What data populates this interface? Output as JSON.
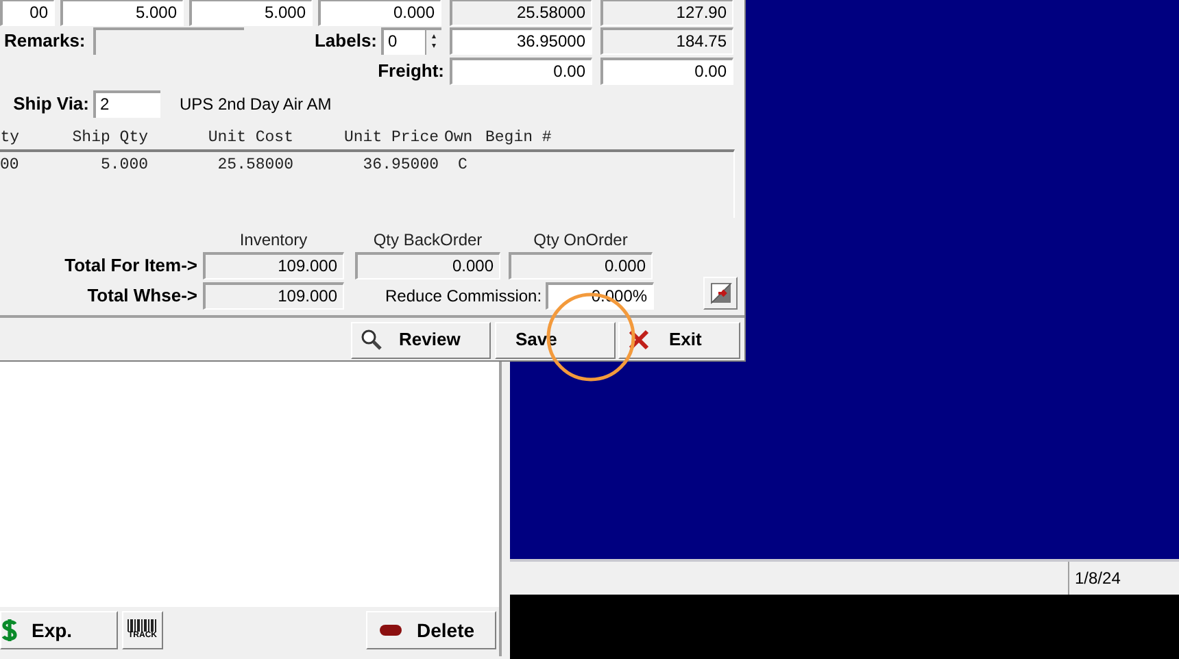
{
  "order_dialog": {
    "line_row": [
      {
        "value": "00",
        "readonly": false
      },
      {
        "value": "5.000",
        "readonly": false
      },
      {
        "value": "5.000",
        "readonly": false
      },
      {
        "value": "0.000",
        "readonly": false
      },
      {
        "value": "25.58000",
        "readonly": true
      },
      {
        "value": "127.90",
        "readonly": true
      }
    ],
    "remarks": {
      "label": "Remarks:"
    },
    "labels": {
      "label": "Labels:",
      "value": "0"
    },
    "price_row": [
      {
        "value": "36.95000",
        "readonly": false
      },
      {
        "value": "184.75",
        "readonly": true
      }
    ],
    "freight": {
      "label": "Freight:",
      "fields": [
        {
          "value": "0.00",
          "readonly": false
        },
        {
          "value": "0.00",
          "readonly": false
        }
      ]
    },
    "ship_via": {
      "label": "Ship Via:",
      "value": "2",
      "description": "UPS 2nd Day Air AM"
    },
    "grid": {
      "columns": [
        "ty",
        "Ship Qty",
        "Unit Cost",
        "Unit Price",
        "Own",
        "Begin #"
      ],
      "rows": [
        [
          "00",
          "5.000",
          "25.58000",
          "36.95000",
          "C"
        ]
      ]
    },
    "totals": {
      "columns": [
        "Inventory",
        "Qty BackOrder",
        "Qty OnOrder"
      ],
      "rows": [
        {
          "label": "Total For Item->",
          "values": [
            "109.000",
            "0.000",
            "0.000"
          ]
        },
        {
          "label": "Total Whse->",
          "values": [
            "109.000"
          ]
        }
      ]
    },
    "reduce_commission": {
      "label": "Reduce Commission:",
      "value": "0.000%"
    },
    "buttons": [
      {
        "kind": "search",
        "label": "Review"
      },
      {
        "kind": "plain",
        "label": "Save"
      },
      {
        "kind": "close",
        "label": "Exit"
      }
    ]
  },
  "lower_window": {
    "buttons": [
      {
        "kind": "money",
        "label": "Exp."
      },
      {
        "kind": "barcode",
        "label": "TRACK"
      },
      {
        "kind": "pill",
        "label": "Delete"
      }
    ]
  },
  "status_bar": {
    "date": "1/8/24"
  }
}
